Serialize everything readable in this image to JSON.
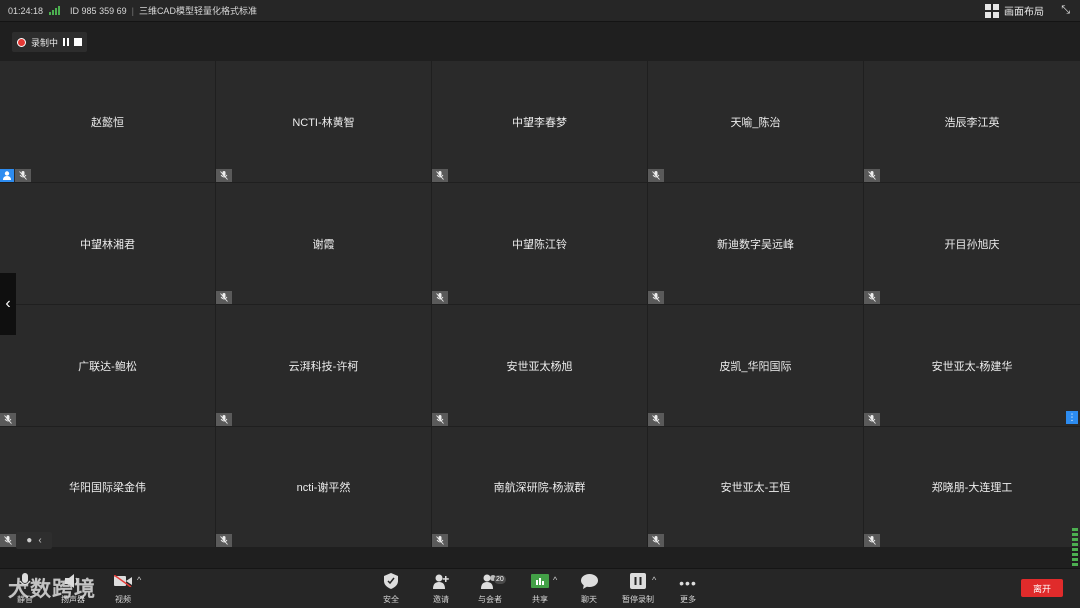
{
  "topbar": {
    "time": "01:24:18",
    "meeting_id": "ID 985 359 69",
    "meeting_title": "三维CAD模型轻量化格式标准",
    "layout_label": "画面布局"
  },
  "recording": {
    "label": "录制中"
  },
  "participants": [
    "赵懿恒",
    "NCTI-林黄智",
    "中望李春梦",
    "天喻_陈治",
    "浩辰李江英",
    "中望林湘君",
    "谢霞",
    "中望陈江铃",
    "新迪数字吴远峰",
    "开目孙旭庆",
    "广联达-鲍松",
    "云湃科技-许柯",
    "安世亚太杨旭",
    "皮凯_华阳国际",
    "安世亚太-杨建华",
    "华阳国际梁金伟",
    "ncti-谢平然",
    "南航深研院-杨淑群",
    "安世亚太-王恒",
    "郑晓朋-大连理工"
  ],
  "toolbar": {
    "unmute": "静音",
    "speaker": "扬声器",
    "video": "视频",
    "security": "安全",
    "invite": "邀请",
    "participants": "与会者",
    "participants_count": "20",
    "share": "共享",
    "chat": "聊天",
    "pause_record": "暂停录制",
    "more": "更多",
    "leave": "离开"
  },
  "watermark": "大数跨境",
  "colors": {
    "leave": "#e02b2b",
    "accent": "#2d8cf0",
    "record": "#e53935"
  }
}
